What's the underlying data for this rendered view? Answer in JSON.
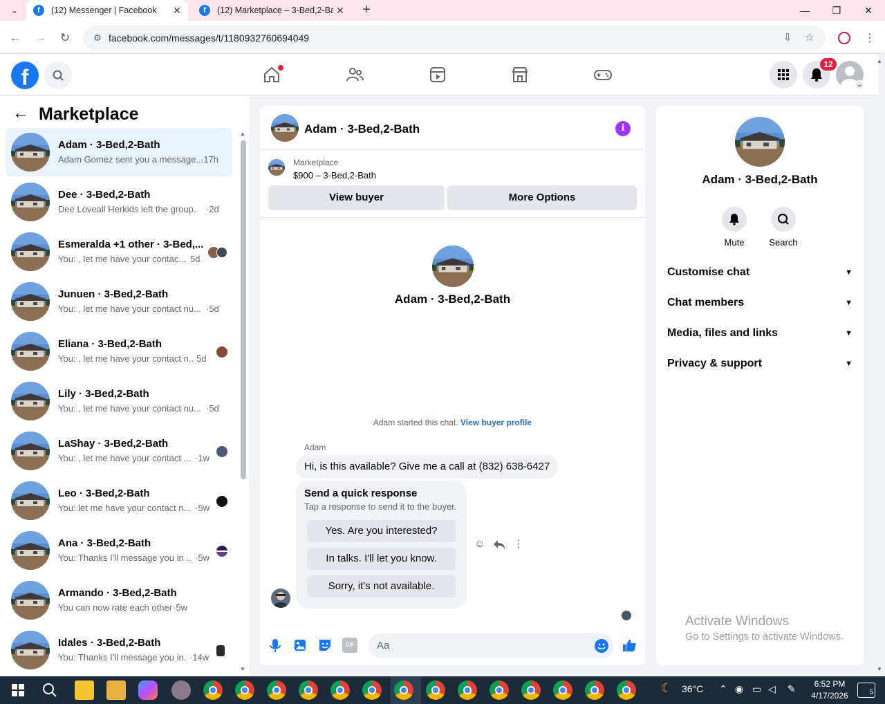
{
  "browser": {
    "tabs": [
      {
        "title": "(12) Messenger | Facebook",
        "active": true
      },
      {
        "title": "(12) Marketplace – 3-Bed,2-Bath",
        "active": false
      }
    ],
    "url": "facebook.com/messages/t/1180932760694049"
  },
  "fbnav": {
    "notification_count": "12"
  },
  "left": {
    "title": "Marketplace",
    "conversations": [
      {
        "name": "Adam · 3-Bed,2-Bath",
        "preview": "Adam Gomez sent you a message...",
        "time": "·17h",
        "selected": true
      },
      {
        "name": "Dee · 3-Bed,2-Bath",
        "preview": "Dee Loveall Herkids left the group.",
        "time": "·2d"
      },
      {
        "name": "Esmeralda +1 other · 3-Bed,...",
        "preview": "You: , let me have your contac...",
        "time": "5d"
      },
      {
        "name": "Junuen · 3-Bed,2-Bath",
        "preview": "You: , let me have your contact nu...",
        "time": "·5d"
      },
      {
        "name": "Eliana · 3-Bed,2-Bath",
        "preview": "You: , let me have your contact n...",
        "time": "5d"
      },
      {
        "name": "Lily · 3-Bed,2-Bath",
        "preview": "You: , let me have your contact nu...",
        "time": "·5d"
      },
      {
        "name": "LaShay · 3-Bed,2-Bath",
        "preview": "You: , let me have your contact ...",
        "time": "·1w"
      },
      {
        "name": "Leo · 3-Bed,2-Bath",
        "preview": "You: let me have your contact n...",
        "time": "·5w"
      },
      {
        "name": "Ana · 3-Bed,2-Bath",
        "preview": "You: Thanks I'll message you in ...",
        "time": "·5w"
      },
      {
        "name": "Armando · 3-Bed,2-Bath",
        "preview": "You can now rate each other",
        "time": "·5w"
      },
      {
        "name": "Idales · 3-Bed,2-Bath",
        "preview": "You: Thanks I'll message you in...",
        "time": "·14w"
      }
    ]
  },
  "chat": {
    "header_name": "Adam · 3-Bed,2-Bath",
    "marketplace_label": "Marketplace",
    "listing": "$900 – 3-Bed,2-Bath",
    "view_buyer": "View buyer",
    "more_options": "More Options",
    "intro_name": "Adam · 3-Bed,2-Bath",
    "started_text": "Adam started this chat.",
    "view_profile": "View buyer profile",
    "sender": "Adam",
    "message": "Hi, is this available? Give me a call at (832) 638-6427",
    "quick_title": "Send a quick response",
    "quick_sub": "Tap a response to send it to the buyer.",
    "quick_options": [
      "Yes. Are you interested?",
      "In talks. I'll let you know.",
      "Sorry, it's not available."
    ],
    "composer_placeholder": "Aa",
    "gif_label": "GIF"
  },
  "right": {
    "name": "Adam · 3-Bed,2-Bath",
    "mute": "Mute",
    "search": "Search",
    "sections": [
      "Customise chat",
      "Chat members",
      "Media, files and links",
      "Privacy & support"
    ],
    "activate_title": "Activate Windows",
    "activate_sub": "Go to Settings to activate Windows."
  },
  "taskbar": {
    "weather": "36°C",
    "time": "6:52 PM",
    "date": "4/17/2026",
    "notif": "5"
  },
  "colors": {
    "fb_blue": "#1877f2",
    "messenger_purple": "#a033ff",
    "selected_bg": "#e7f3ff",
    "badge_red": "#e41e3f"
  }
}
